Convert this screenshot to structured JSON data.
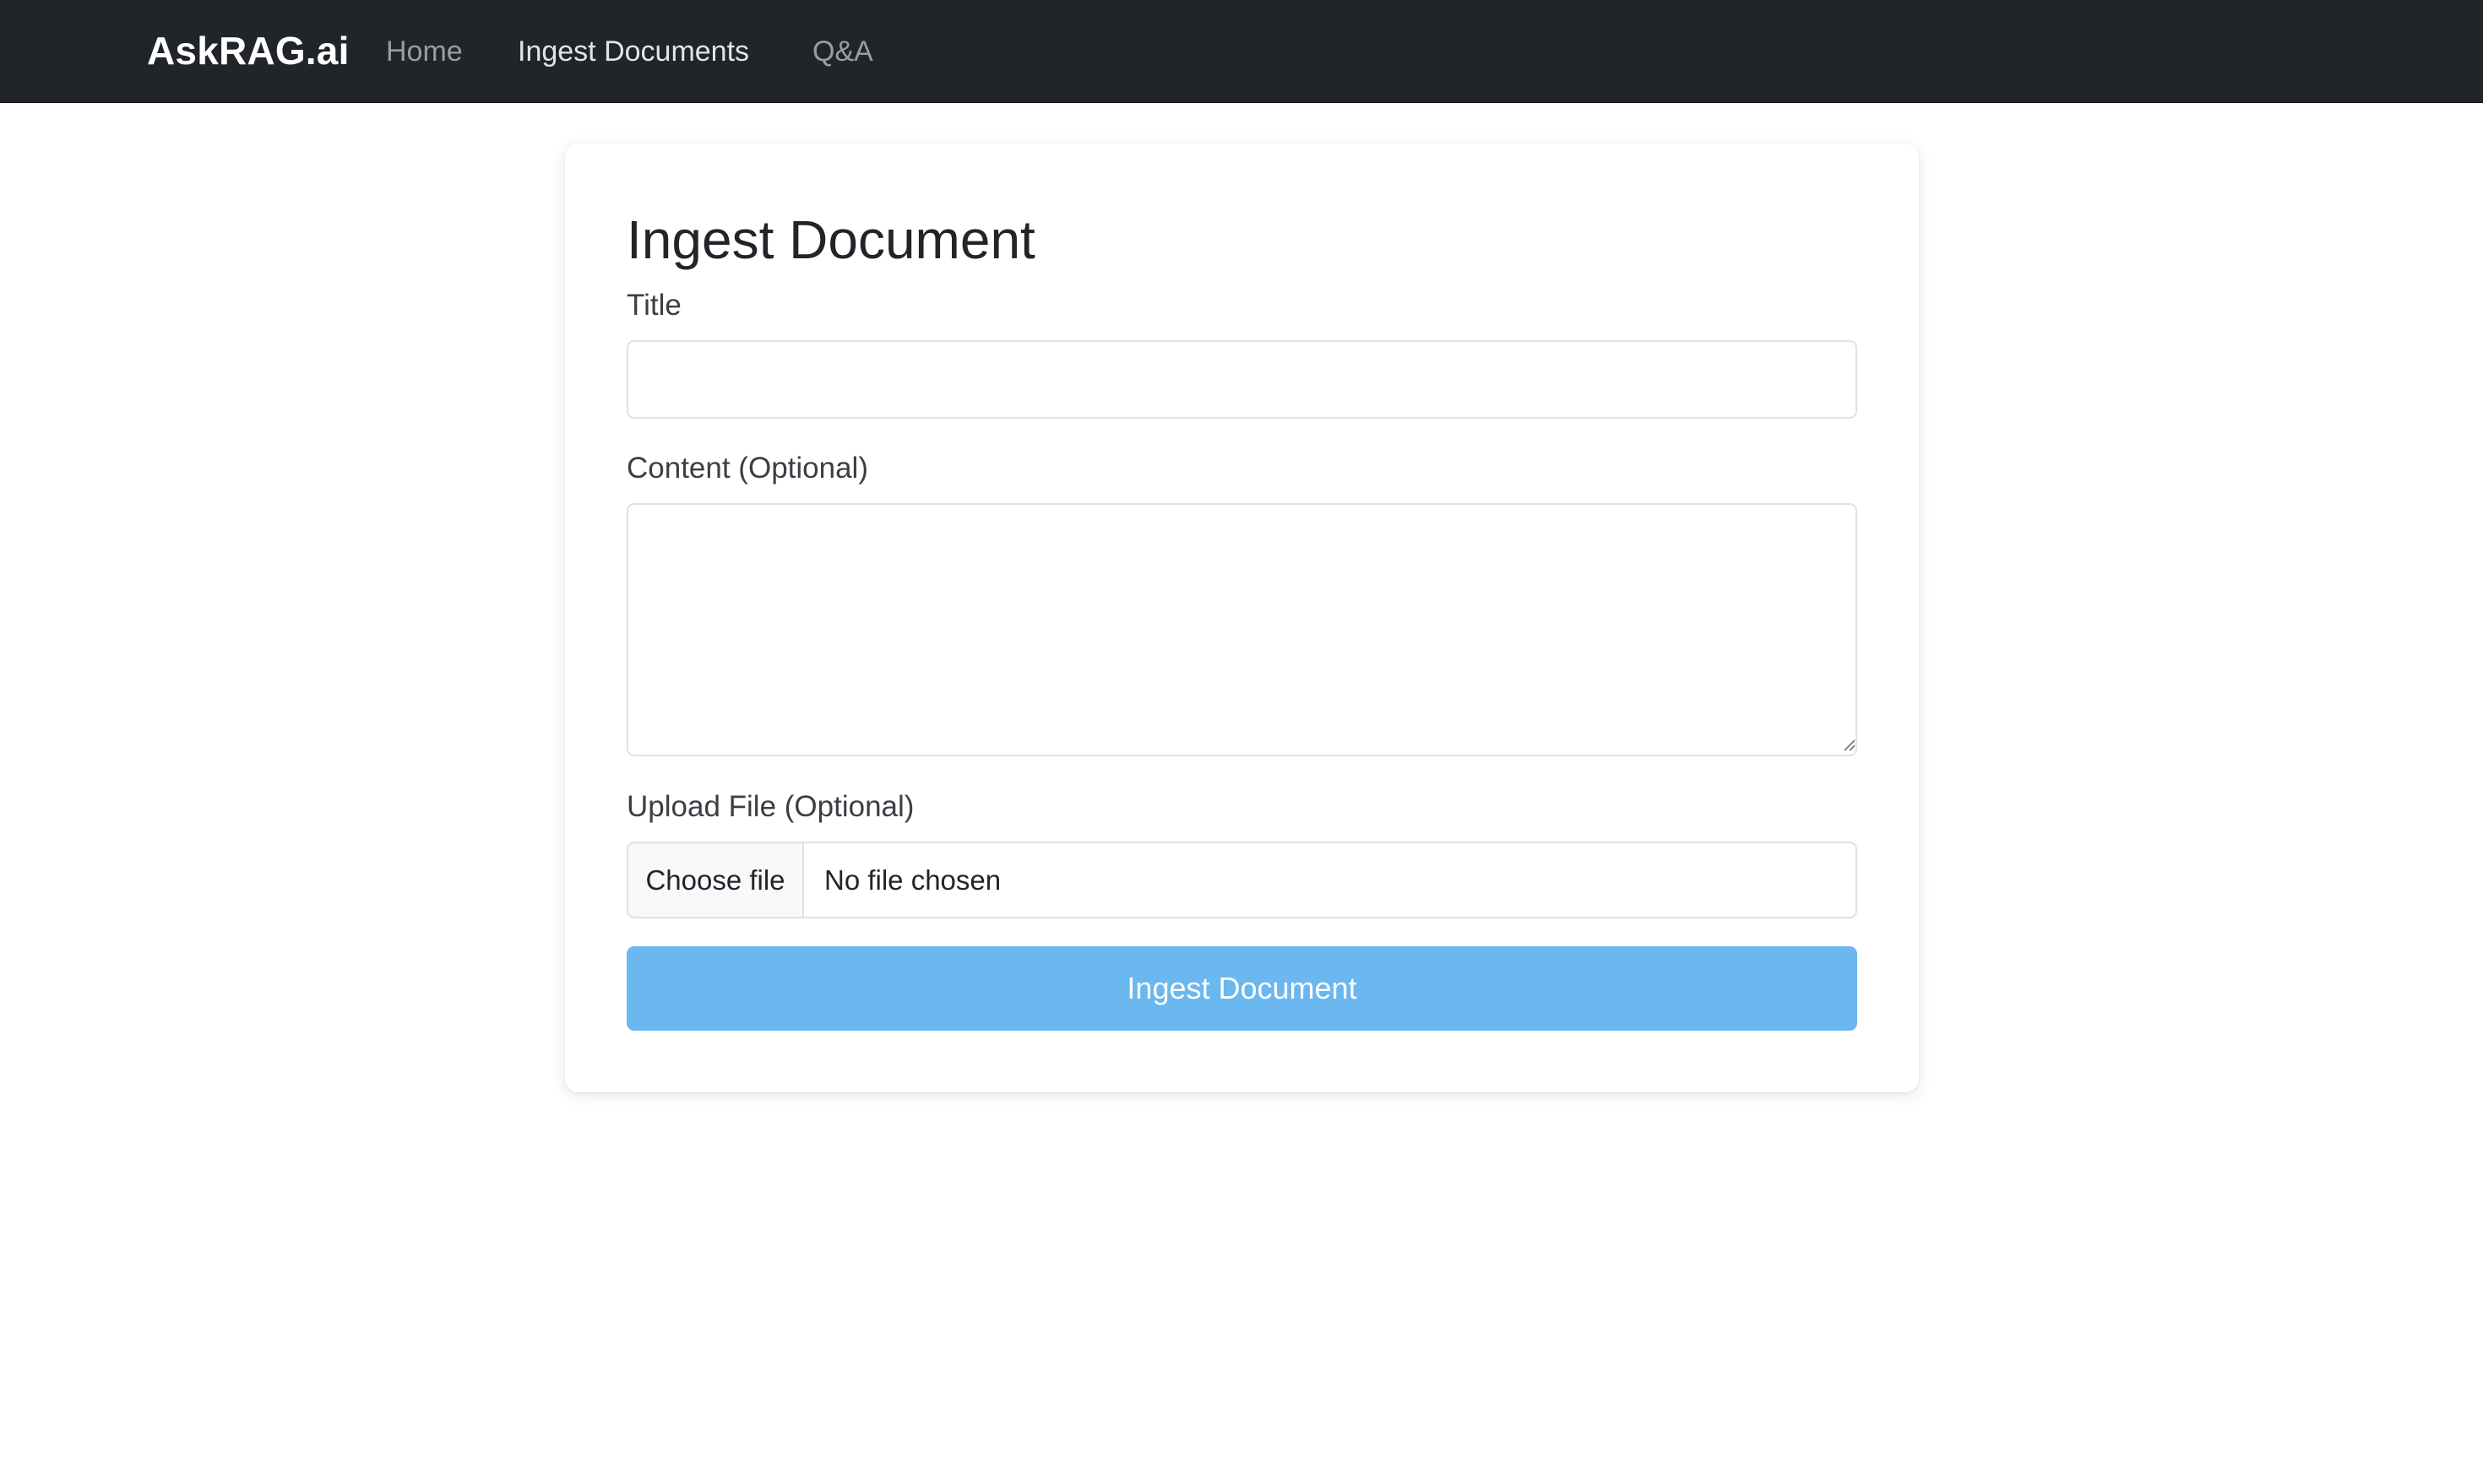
{
  "navbar": {
    "brand": "AskRAG.ai",
    "links": [
      {
        "label": "Home",
        "active": false
      },
      {
        "label": "Ingest Documents",
        "active": true
      },
      {
        "label": "Q&A",
        "active": false
      }
    ]
  },
  "form": {
    "heading": "Ingest Document",
    "title_label": "Title",
    "title_value": "",
    "content_label": "Content (Optional)",
    "content_value": "",
    "upload_label": "Upload File (Optional)",
    "file_button_label": "Choose file",
    "file_status": "No file chosen",
    "submit_label": "Ingest Document"
  },
  "colors": {
    "navbar_bg": "#212529",
    "submit_bg": "#6bb7ef",
    "border": "#dee2e6"
  }
}
